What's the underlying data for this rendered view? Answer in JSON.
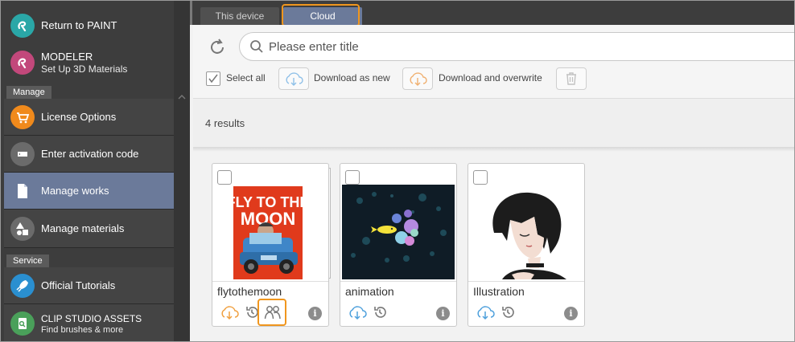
{
  "sidebar": {
    "top": [
      {
        "label": "Return to PAINT",
        "sub": "",
        "icon": "clip-studio-paint-icon",
        "color": "#2aa7a7"
      },
      {
        "label": "MODELER",
        "sub": "Set Up 3D Materials",
        "icon": "clip-studio-modeler-icon",
        "color": "#c2487b"
      }
    ],
    "manage_header": "Manage",
    "manage": [
      {
        "label": "License Options",
        "icon": "cart-icon",
        "color": "#f08a1c"
      },
      {
        "label": "Enter activation code",
        "icon": "ticket-icon",
        "color": "#6b6b6b"
      },
      {
        "label": "Manage works",
        "icon": "document-icon",
        "color": "#6b7a9a"
      },
      {
        "label": "Manage materials",
        "icon": "shapes-icon",
        "color": "#6b6b6b"
      }
    ],
    "service_header": "Service",
    "service": [
      {
        "label": "Official Tutorials",
        "sub": "",
        "icon": "rocket-icon",
        "color": "#2a8fd0"
      },
      {
        "label": "CLIP STUDIO ASSETS",
        "sub": "Find brushes & more",
        "icon": "assets-icon",
        "color": "#4aa05a"
      }
    ]
  },
  "tabs": {
    "device": "This device",
    "cloud": "Cloud"
  },
  "search": {
    "placeholder": "Please enter title"
  },
  "toolbar": {
    "select_all": "Select all",
    "download_new": "Download as new",
    "download_overwrite": "Download and overwrite"
  },
  "results": "4 results",
  "works": [
    {
      "title": "flytothemoon",
      "cover_text_1": "FLY TO THE",
      "cover_text_2": "MOON"
    },
    {
      "title": "animation"
    },
    {
      "title": "Illustration"
    }
  ],
  "colors": {
    "accent_highlight": "#f0961e",
    "active_tab": "#6b7a9a",
    "sidebar_bg": "#3d3d3d"
  }
}
